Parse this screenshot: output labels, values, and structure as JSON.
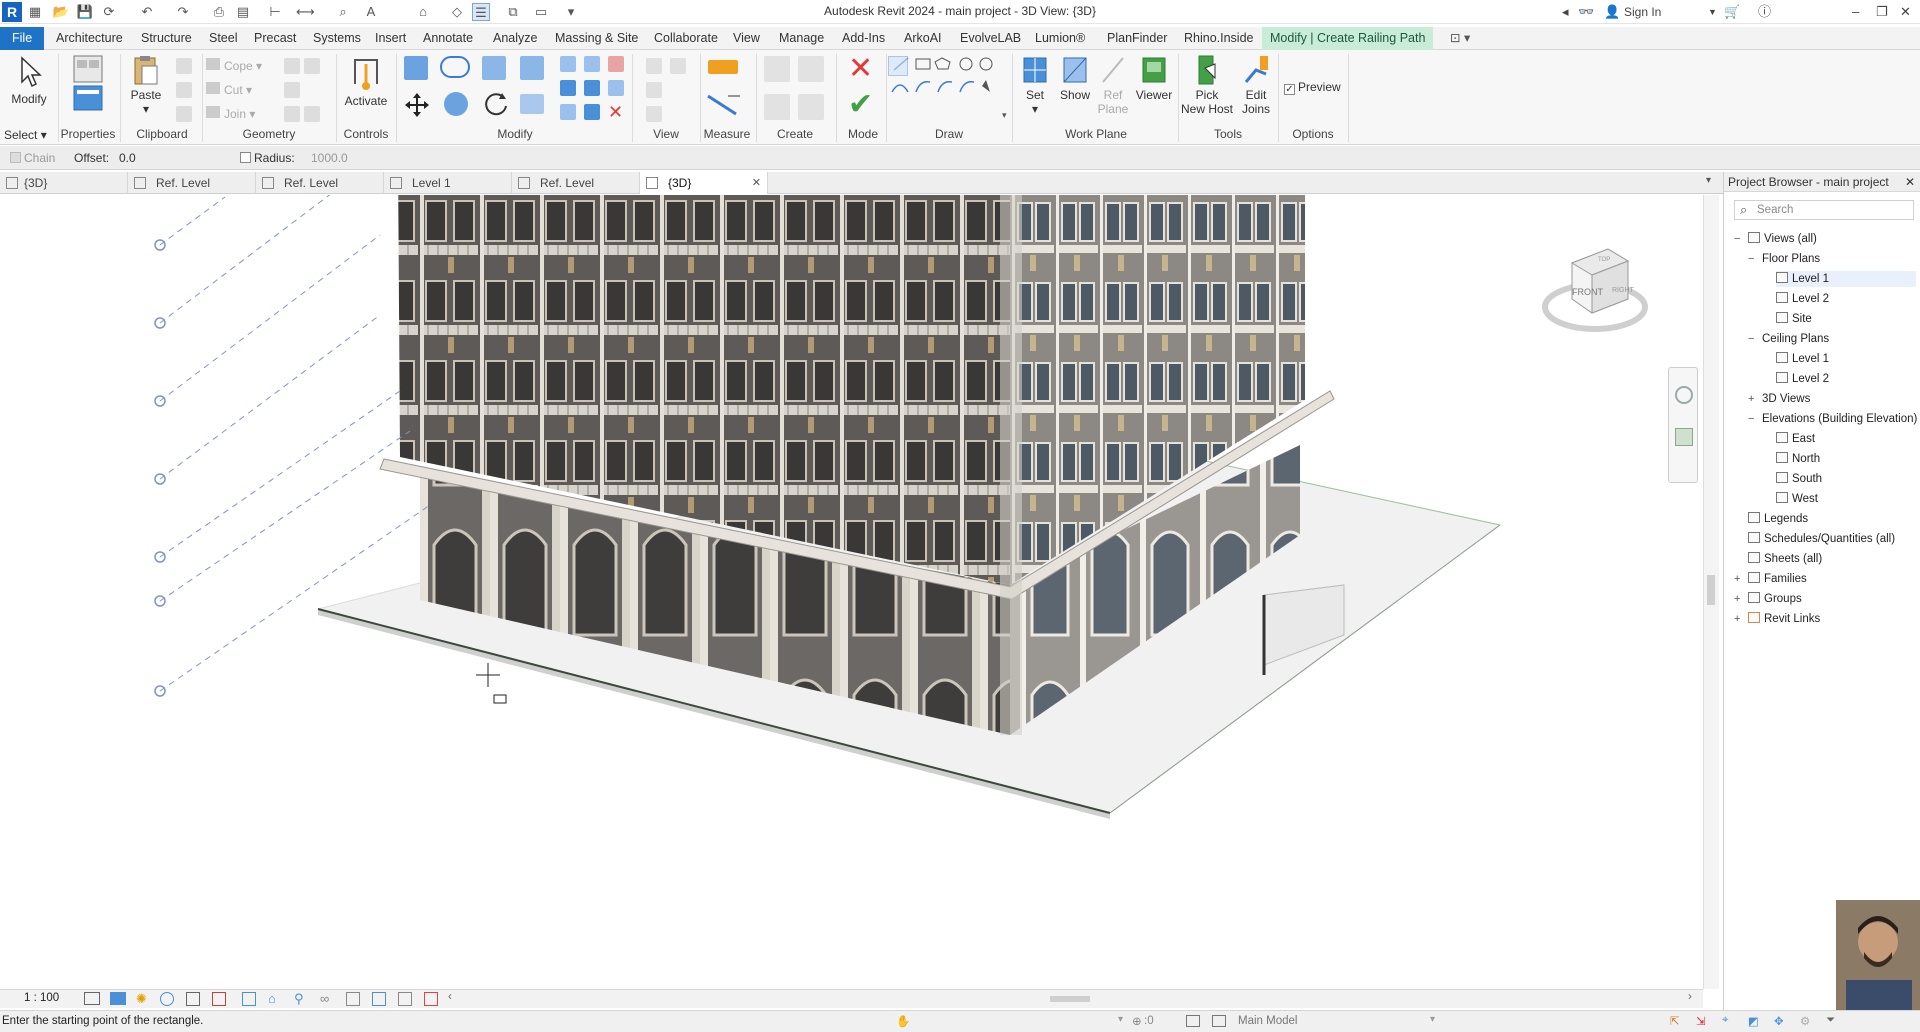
{
  "window": {
    "title": "Autodesk Revit 2024 - main project - 3D View: {3D}",
    "sign_in": "Sign In",
    "app_letter": "R"
  },
  "ribbon_tabs": [
    "File",
    "Architecture",
    "Structure",
    "Steel",
    "Precast",
    "Systems",
    "Insert",
    "Annotate",
    "Analyze",
    "Massing & Site",
    "Collaborate",
    "View",
    "Manage",
    "Add-Ins",
    "ArkoAI",
    "EvolveLAB",
    "Lumion®",
    "PlanFinder",
    "Rhino.Inside",
    "Modify | Create Railing Path"
  ],
  "ribbon": {
    "modify": "Modify",
    "select": "Select",
    "properties": "Properties",
    "paste": "Paste",
    "clipboard": "Clipboard",
    "cope": "Cope",
    "cut": "Cut",
    "join": "Join",
    "geometry": "Geometry",
    "activate": "Activate",
    "controls": "Controls",
    "modify_panel": "Modify",
    "view_panel": "View",
    "measure": "Measure",
    "create": "Create",
    "mode": "Mode",
    "draw": "Draw",
    "set": "Set",
    "show": "Show",
    "ref_plane_1": "Ref",
    "ref_plane_2": "Plane",
    "viewer": "Viewer",
    "work_plane": "Work Plane",
    "pick_new_host_1": "Pick",
    "pick_new_host_2": "New Host",
    "edit_joins_1": "Edit",
    "edit_joins_2": "Joins",
    "tools": "Tools",
    "preview": "Preview",
    "options": "Options"
  },
  "options_bar": {
    "chain": "Chain",
    "offset_label": "Offset:",
    "offset_value": "0.0",
    "radius_label": "Radius:",
    "radius_value": "1000.0"
  },
  "view_tabs": [
    {
      "label": "{3D}",
      "active": false
    },
    {
      "label": "Ref. Level",
      "active": false
    },
    {
      "label": "Ref. Level",
      "active": false
    },
    {
      "label": "Level 1",
      "active": false
    },
    {
      "label": "Ref. Level",
      "active": false
    },
    {
      "label": "{3D}",
      "active": true
    }
  ],
  "viewcube": {
    "front": "FRONT",
    "right": "RIGHT",
    "top": "TOP"
  },
  "project_browser": {
    "title": "Project Browser - main project",
    "search_placeholder": "Search",
    "views_all": "Views (all)",
    "floor_plans": "Floor Plans",
    "fp_level1": "Level 1",
    "fp_level2": "Level 2",
    "fp_site": "Site",
    "ceiling_plans": "Ceiling Plans",
    "cp_level1": "Level 1",
    "cp_level2": "Level 2",
    "views_3d": "3D Views",
    "elevations": "Elevations (Building Elevation)",
    "east": "East",
    "north": "North",
    "south": "South",
    "west": "West",
    "legends": "Legends",
    "schedules": "Schedules/Quantities (all)",
    "sheets": "Sheets (all)",
    "families": "Families",
    "groups": "Groups",
    "revit_links": "Revit Links"
  },
  "view_control": {
    "scale": "1 : 100"
  },
  "status": {
    "prompt": "Enter the starting point of the rectangle.",
    "selection_count": ":0",
    "model": "Main Model"
  },
  "colors": {
    "file_tab": "#1f73c7",
    "contextual_tab": "#c8ecd8",
    "cancel": "#e53935",
    "finish": "#43a047"
  }
}
